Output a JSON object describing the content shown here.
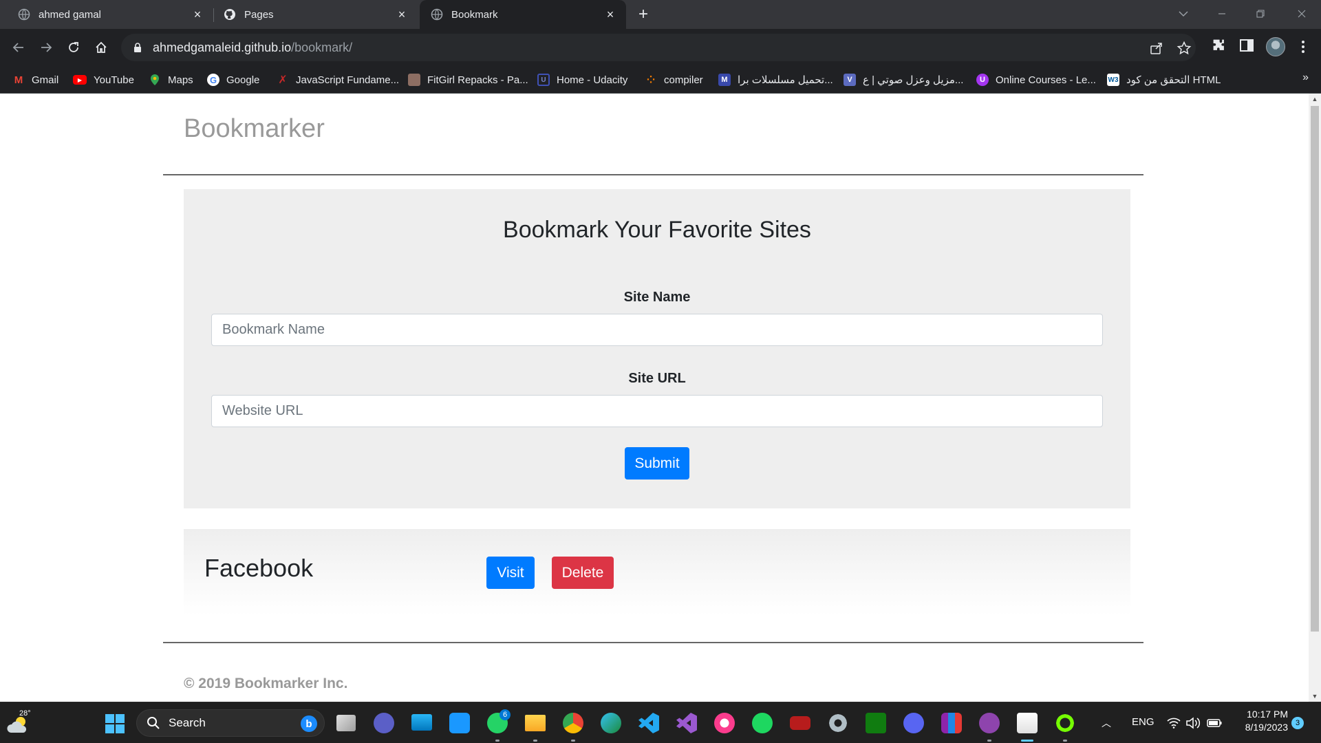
{
  "browser": {
    "tabs": [
      {
        "title": "ahmed gamal",
        "icon": "globe-icon",
        "active": false
      },
      {
        "title": "Pages",
        "icon": "github-icon",
        "active": false
      },
      {
        "title": "Bookmark",
        "icon": "globe-icon",
        "active": true
      }
    ],
    "url_host": "ahmedgamaleid.github.io",
    "url_path": "/bookmark/",
    "bookmarks": [
      {
        "label": "Gmail",
        "icon": "gmail-icon",
        "color": "#ea4335"
      },
      {
        "label": "YouTube",
        "icon": "youtube-icon",
        "color": "#ff0000"
      },
      {
        "label": "Maps",
        "icon": "maps-icon",
        "color": "#34a853"
      },
      {
        "label": "Google",
        "icon": "google-icon",
        "color": "#4285f4"
      },
      {
        "label": "JavaScript Fundame...",
        "icon": "javascript-icon",
        "color": "#c62828"
      },
      {
        "label": "FitGirl Repacks - Pa...",
        "icon": "fitgirl-icon",
        "color": "#8d6e63"
      },
      {
        "label": "Home - Udacity",
        "icon": "udacity-icon",
        "color": "#1e3a8a"
      },
      {
        "label": "compiler",
        "icon": "compiler-icon",
        "color": "#f57c00"
      },
      {
        "label": "تحميل مسلسلات برا...",
        "icon": "m-icon",
        "color": "#3949ab"
      },
      {
        "label": "مزيل وعزل صوتي | ع...",
        "icon": "v-icon",
        "color": "#5c6bc0"
      },
      {
        "label": "Online Courses - Le...",
        "icon": "udemy-icon",
        "color": "#a435f0"
      },
      {
        "label": "التحقق من كود HTML",
        "icon": "w3c-icon",
        "color": "#005a9c"
      }
    ]
  },
  "page": {
    "brand": "Bookmarker",
    "form": {
      "title": "Bookmark Your Favorite Sites",
      "site_name_label": "Site Name",
      "site_name_placeholder": "Bookmark Name",
      "site_url_label": "Site URL",
      "site_url_placeholder": "Website URL",
      "submit_label": "Submit"
    },
    "bookmarks": [
      {
        "name": "Facebook",
        "visit_label": "Visit",
        "delete_label": "Delete"
      }
    ],
    "footer": "© 2019 Bookmarker Inc."
  },
  "taskbar": {
    "weather": "28°",
    "search_label": "Search",
    "whatsapp_badge": "6",
    "language": "ENG",
    "time": "10:17 PM",
    "date": "8/19/2023",
    "notification_count": "3"
  },
  "colors": {
    "primary": "#007bff",
    "danger": "#dc3545",
    "panel": "#eeeeee",
    "brand_text": "#999999"
  }
}
